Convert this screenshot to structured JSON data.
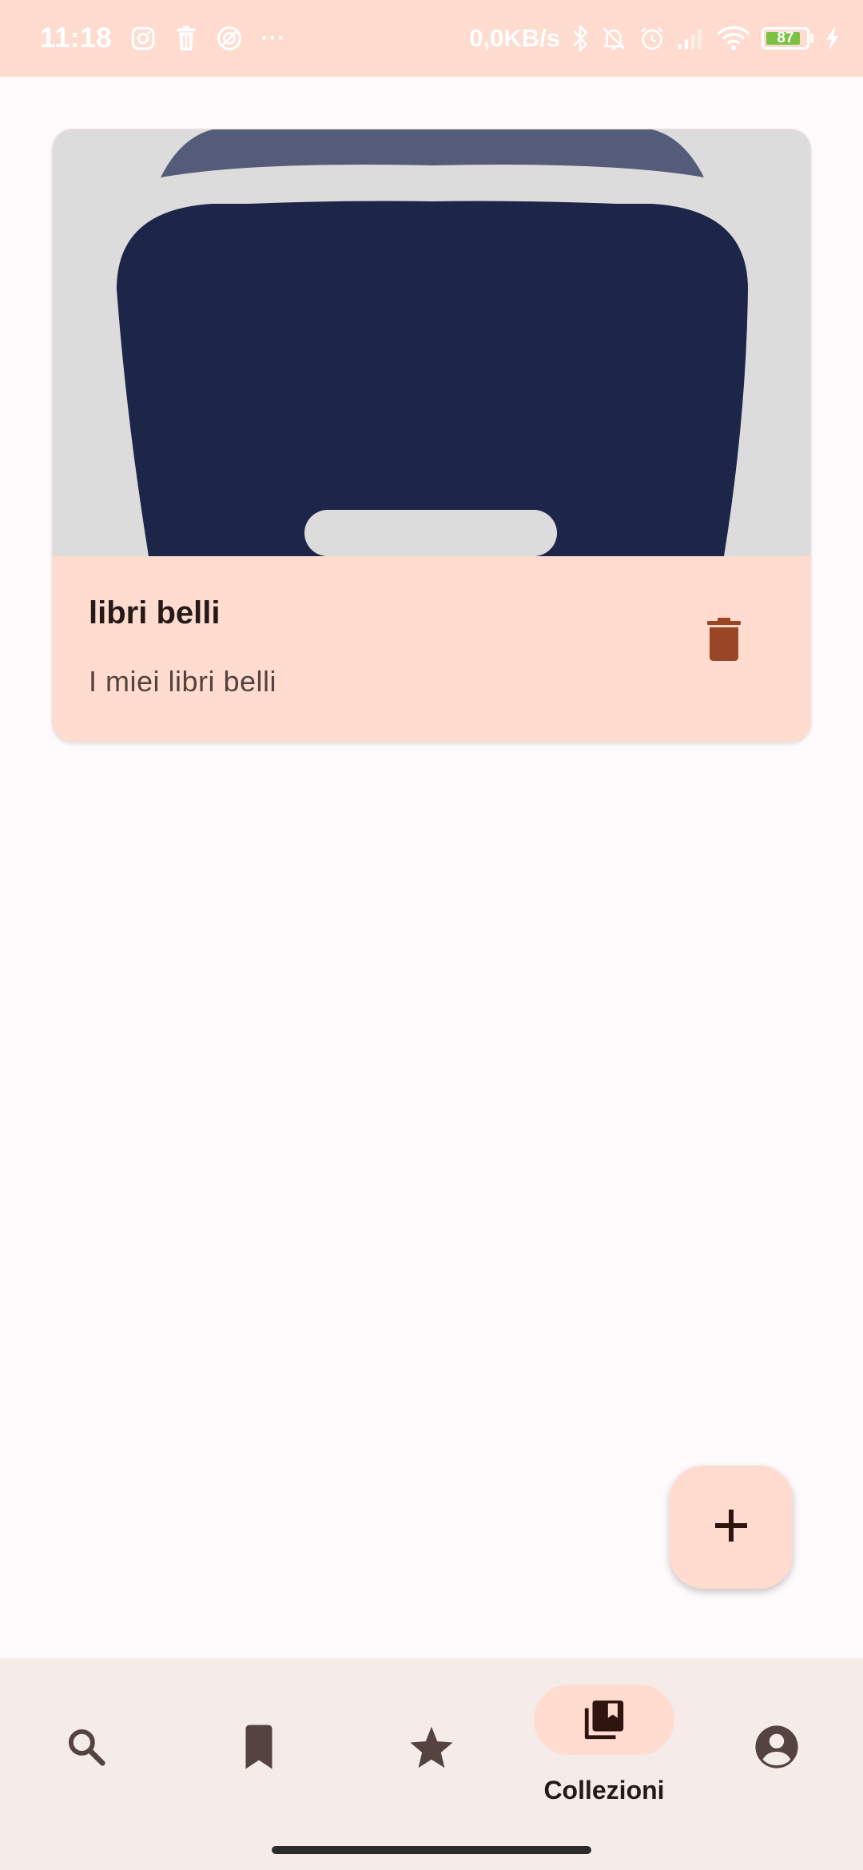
{
  "status_bar": {
    "time": "11:18",
    "more": "···",
    "network_speed": "0,0KB/s",
    "battery_level": "87",
    "battery_fraction": 0.87,
    "background_color": "#ffdccf",
    "left_icons": [
      "instagram-icon",
      "trash-notification-icon",
      "vpn-icon",
      "more-icon"
    ],
    "right_icons": [
      "bluetooth-icon",
      "bell-off-icon",
      "alarm-icon",
      "signal-icon",
      "wifi-icon",
      "battery-icon",
      "charging-icon"
    ]
  },
  "collection_card": {
    "title": "libri belli",
    "subtitle": "I miei libri belli",
    "delete_icon": "trash-icon",
    "image_bg_color": "#dcdcdc",
    "cover_color": "#1d2649",
    "background_color": "#ffdccf"
  },
  "fab": {
    "icon": "plus-icon",
    "background_color": "#ffdbd0"
  },
  "bottom_nav": {
    "items": [
      {
        "icon": "search-icon",
        "label": "",
        "active": false
      },
      {
        "icon": "bookmark-icon",
        "label": "",
        "active": false
      },
      {
        "icon": "star-icon",
        "label": "",
        "active": false
      },
      {
        "icon": "collections-icon",
        "label": "Collezioni",
        "active": true
      },
      {
        "icon": "account-icon",
        "label": "",
        "active": false
      }
    ],
    "active_pill_color": "#ffdccf",
    "background_color": "#f5ebe9"
  }
}
